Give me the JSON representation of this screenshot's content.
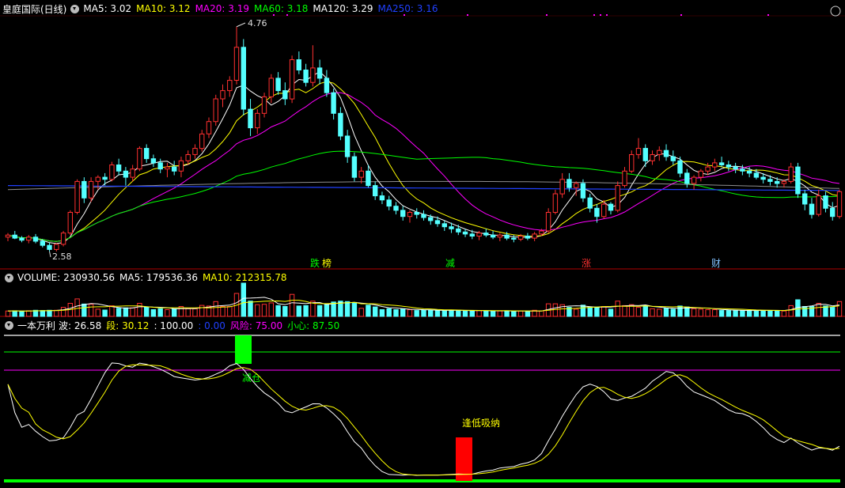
{
  "header_main": {
    "name": "皇庭国际(日线)",
    "ma": [
      {
        "label": "MA5: 3.02",
        "color": "#ffffff"
      },
      {
        "label": "MA10: 3.12",
        "color": "#ffff00"
      },
      {
        "label": "MA20: 3.19",
        "color": "#ff00ff"
      },
      {
        "label": "MA60: 3.18",
        "color": "#00ff00"
      },
      {
        "label": "MA120: 3.29",
        "color": "#ffffff"
      },
      {
        "label": "MA250: 3.16",
        "color": "#2040ff"
      }
    ]
  },
  "header_volume": {
    "items": [
      {
        "label": "VOLUME: 230930.56",
        "color": "#ffffff"
      },
      {
        "label": "MA5: 179536.36",
        "color": "#ffffff"
      },
      {
        "label": "MA10: 212315.78",
        "color": "#ffff00"
      }
    ]
  },
  "header_indicator": {
    "name": "一本万利",
    "items": [
      {
        "label": "波: 26.58",
        "color": "#ffffff"
      },
      {
        "label": "段: 30.12",
        "color": "#ffff00"
      },
      {
        "label": ": 100.00",
        "color": "#ffffff"
      },
      {
        "label": ": 0.00",
        "color": "#2040ff"
      },
      {
        "label": "风险: 75.00",
        "color": "#ff00ff"
      },
      {
        "label": "小心: 87.50",
        "color": "#00ff00"
      }
    ]
  },
  "annotations": {
    "high_price": "4.76",
    "low_price": "2.58",
    "signals": [
      {
        "text": "跌",
        "color": "#00ff00"
      },
      {
        "text": "榜",
        "color": "#ffff00"
      },
      {
        "text": "减",
        "color": "#00ff00"
      },
      {
        "text": "涨",
        "color": "#ff3030"
      },
      {
        "text": "财",
        "color": "#80c0ff"
      }
    ],
    "reduce_label": "减仓",
    "buy_label": "逢低吸纳"
  },
  "chart_data": {
    "type": "candlestick",
    "price_range": [
      2.45,
      4.85
    ],
    "candles": [
      [
        2.72,
        2.76,
        2.68,
        2.74
      ],
      [
        2.74,
        2.78,
        2.7,
        2.71
      ],
      [
        2.71,
        2.73,
        2.67,
        2.69
      ],
      [
        2.69,
        2.74,
        2.66,
        2.72
      ],
      [
        2.72,
        2.75,
        2.66,
        2.68
      ],
      [
        2.68,
        2.7,
        2.62,
        2.64
      ],
      [
        2.64,
        2.67,
        2.58,
        2.6
      ],
      [
        2.6,
        2.66,
        2.58,
        2.65
      ],
      [
        2.65,
        2.78,
        2.63,
        2.76
      ],
      [
        2.76,
        2.98,
        2.74,
        2.96
      ],
      [
        2.96,
        3.28,
        2.94,
        3.26
      ],
      [
        3.26,
        3.3,
        3.05,
        3.1
      ],
      [
        3.1,
        3.3,
        3.06,
        3.26
      ],
      [
        3.26,
        3.32,
        3.18,
        3.3
      ],
      [
        3.3,
        3.34,
        3.22,
        3.28
      ],
      [
        3.28,
        3.45,
        3.26,
        3.42
      ],
      [
        3.42,
        3.48,
        3.32,
        3.36
      ],
      [
        3.36,
        3.4,
        3.22,
        3.3
      ],
      [
        3.3,
        3.42,
        3.26,
        3.38
      ],
      [
        3.38,
        3.6,
        3.36,
        3.58
      ],
      [
        3.58,
        3.62,
        3.44,
        3.48
      ],
      [
        3.48,
        3.52,
        3.4,
        3.44
      ],
      [
        3.44,
        3.48,
        3.34,
        3.38
      ],
      [
        3.38,
        3.44,
        3.3,
        3.4
      ],
      [
        3.4,
        3.46,
        3.32,
        3.36
      ],
      [
        3.36,
        3.5,
        3.3,
        3.46
      ],
      [
        3.46,
        3.56,
        3.42,
        3.52
      ],
      [
        3.52,
        3.62,
        3.48,
        3.58
      ],
      [
        3.58,
        3.76,
        3.55,
        3.72
      ],
      [
        3.72,
        3.88,
        3.68,
        3.84
      ],
      [
        3.84,
        4.1,
        3.8,
        4.06
      ],
      [
        4.06,
        4.2,
        3.98,
        4.14
      ],
      [
        4.14,
        4.28,
        4.08,
        4.24
      ],
      [
        4.24,
        4.76,
        4.2,
        4.56
      ],
      [
        4.56,
        4.64,
        3.9,
        3.96
      ],
      [
        3.96,
        4.06,
        3.7,
        3.78
      ],
      [
        3.78,
        3.96,
        3.72,
        3.92
      ],
      [
        3.92,
        4.12,
        3.88,
        4.08
      ],
      [
        4.08,
        4.3,
        4.02,
        4.26
      ],
      [
        4.26,
        4.32,
        4.1,
        4.14
      ],
      [
        4.14,
        4.22,
        4.0,
        4.06
      ],
      [
        4.06,
        4.48,
        4.02,
        4.44
      ],
      [
        4.44,
        4.52,
        4.3,
        4.34
      ],
      [
        4.34,
        4.4,
        4.18,
        4.22
      ],
      [
        4.22,
        4.58,
        4.18,
        4.36
      ],
      [
        4.36,
        4.44,
        4.2,
        4.26
      ],
      [
        4.26,
        4.34,
        4.08,
        4.12
      ],
      [
        4.12,
        4.16,
        3.86,
        3.92
      ],
      [
        3.92,
        3.98,
        3.66,
        3.7
      ],
      [
        3.7,
        3.76,
        3.44,
        3.5
      ],
      [
        3.5,
        3.54,
        3.26,
        3.3
      ],
      [
        3.3,
        3.4,
        3.24,
        3.36
      ],
      [
        3.36,
        3.42,
        3.2,
        3.22
      ],
      [
        3.22,
        3.26,
        3.08,
        3.12
      ],
      [
        3.12,
        3.16,
        3.04,
        3.08
      ],
      [
        3.08,
        3.12,
        2.98,
        3.02
      ],
      [
        3.02,
        3.06,
        2.94,
        2.98
      ],
      [
        2.98,
        3.02,
        2.88,
        2.92
      ],
      [
        2.92,
        2.98,
        2.86,
        2.96
      ],
      [
        2.96,
        3.0,
        2.9,
        2.94
      ],
      [
        2.94,
        2.98,
        2.88,
        2.91
      ],
      [
        2.91,
        2.94,
        2.84,
        2.88
      ],
      [
        2.88,
        2.92,
        2.82,
        2.85
      ],
      [
        2.85,
        2.88,
        2.78,
        2.82
      ],
      [
        2.82,
        2.86,
        2.76,
        2.8
      ],
      [
        2.8,
        2.84,
        2.74,
        2.77
      ],
      [
        2.77,
        2.8,
        2.72,
        2.75
      ],
      [
        2.75,
        2.79,
        2.7,
        2.73
      ],
      [
        2.73,
        2.78,
        2.69,
        2.76
      ],
      [
        2.76,
        2.8,
        2.72,
        2.74
      ],
      [
        2.74,
        2.78,
        2.7,
        2.72
      ],
      [
        2.72,
        2.76,
        2.68,
        2.74
      ],
      [
        2.74,
        2.77,
        2.69,
        2.71
      ],
      [
        2.71,
        2.74,
        2.67,
        2.7
      ],
      [
        2.7,
        2.75,
        2.68,
        2.73
      ],
      [
        2.73,
        2.76,
        2.69,
        2.71
      ],
      [
        2.71,
        2.77,
        2.68,
        2.75
      ],
      [
        2.75,
        2.8,
        2.73,
        2.78
      ],
      [
        2.78,
        3.0,
        2.76,
        2.96
      ],
      [
        2.96,
        3.18,
        2.94,
        3.14
      ],
      [
        3.14,
        3.34,
        3.1,
        3.28
      ],
      [
        3.28,
        3.34,
        3.16,
        3.2
      ],
      [
        3.2,
        3.26,
        3.12,
        3.24
      ],
      [
        3.24,
        3.28,
        3.06,
        3.1
      ],
      [
        3.1,
        3.14,
        2.96,
        3.0
      ],
      [
        3.0,
        3.04,
        2.86,
        2.92
      ],
      [
        2.92,
        3.08,
        2.9,
        3.04
      ],
      [
        3.04,
        3.06,
        2.94,
        2.98
      ],
      [
        2.98,
        3.26,
        2.96,
        3.22
      ],
      [
        3.22,
        3.4,
        3.2,
        3.36
      ],
      [
        3.36,
        3.56,
        3.34,
        3.52
      ],
      [
        3.52,
        3.68,
        3.48,
        3.58
      ],
      [
        3.58,
        3.62,
        3.4,
        3.46
      ],
      [
        3.46,
        3.56,
        3.42,
        3.52
      ],
      [
        3.52,
        3.6,
        3.46,
        3.56
      ],
      [
        3.56,
        3.62,
        3.46,
        3.5
      ],
      [
        3.5,
        3.56,
        3.42,
        3.46
      ],
      [
        3.46,
        3.5,
        3.3,
        3.34
      ],
      [
        3.34,
        3.38,
        3.2,
        3.24
      ],
      [
        3.24,
        3.32,
        3.18,
        3.3
      ],
      [
        3.3,
        3.38,
        3.26,
        3.36
      ],
      [
        3.36,
        3.44,
        3.32,
        3.4
      ],
      [
        3.4,
        3.48,
        3.36,
        3.44
      ],
      [
        3.44,
        3.5,
        3.4,
        3.42
      ],
      [
        3.42,
        3.46,
        3.36,
        3.4
      ],
      [
        3.4,
        3.44,
        3.34,
        3.38
      ],
      [
        3.38,
        3.42,
        3.32,
        3.36
      ],
      [
        3.36,
        3.4,
        3.3,
        3.34
      ],
      [
        3.34,
        3.38,
        3.28,
        3.3
      ],
      [
        3.3,
        3.34,
        3.24,
        3.28
      ],
      [
        3.28,
        3.32,
        3.22,
        3.26
      ],
      [
        3.26,
        3.3,
        3.2,
        3.24
      ],
      [
        3.24,
        3.28,
        3.2,
        3.26
      ],
      [
        3.26,
        3.44,
        3.24,
        3.4
      ],
      [
        3.4,
        3.44,
        3.1,
        3.14
      ],
      [
        3.14,
        3.18,
        2.98,
        3.04
      ],
      [
        3.04,
        3.1,
        2.9,
        2.94
      ],
      [
        2.94,
        3.18,
        2.92,
        3.12
      ],
      [
        3.12,
        3.16,
        2.96,
        3.0
      ],
      [
        3.0,
        3.06,
        2.88,
        2.92
      ],
      [
        2.92,
        3.18,
        2.9,
        3.16
      ]
    ],
    "signal_indices": [
      78,
      115
    ],
    "reduce_index": 33,
    "buy_index": 63
  }
}
